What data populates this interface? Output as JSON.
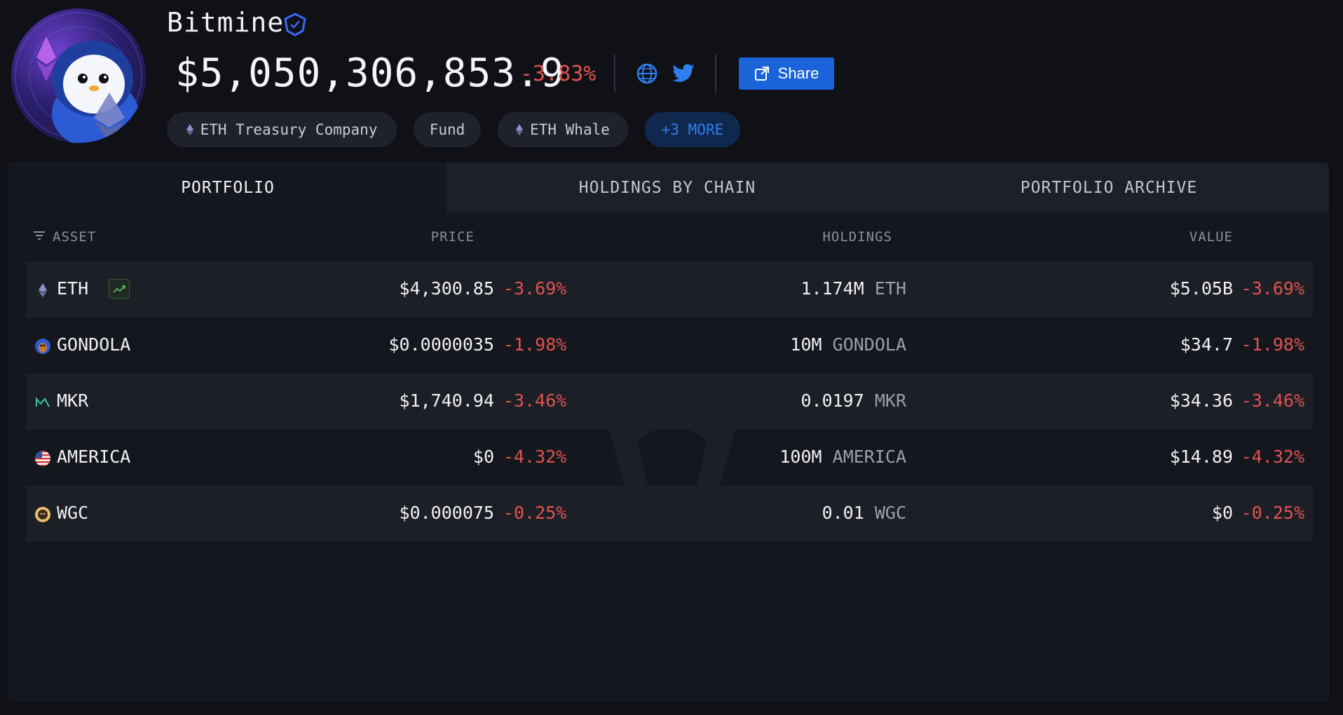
{
  "entity": {
    "name": "Bitmine",
    "total_value": "$5,050,306,853.9",
    "total_change": "-3.83%",
    "share_label": "Share",
    "tags": [
      {
        "label": "ETH Treasury Company",
        "icon": "eth-icon"
      },
      {
        "label": "Fund",
        "icon": ""
      },
      {
        "label": "ETH Whale",
        "icon": "eth-icon"
      },
      {
        "label": "+3 MORE",
        "icon": ""
      }
    ]
  },
  "tabs": [
    {
      "label": "PORTFOLIO",
      "active": true
    },
    {
      "label": "HOLDINGS BY CHAIN",
      "active": false
    },
    {
      "label": "PORTFOLIO ARCHIVE",
      "active": false
    }
  ],
  "table": {
    "headers": {
      "asset": "ASSET",
      "price": "PRICE",
      "holdings": "HOLDINGS",
      "value": "VALUE"
    },
    "rows": [
      {
        "symbol": "ETH",
        "icon": "eth-icon",
        "price": "$4,300.85",
        "price_change": "-3.69%",
        "holdings_amount": "1.174M",
        "holdings_unit": "ETH",
        "value": "$5.05B",
        "value_change": "-3.69%"
      },
      {
        "symbol": "GONDOLA",
        "icon": "gondola-icon",
        "price": "$0.0000035",
        "price_change": "-1.98%",
        "holdings_amount": "10M",
        "holdings_unit": "GONDOLA",
        "value": "$34.7",
        "value_change": "-1.98%"
      },
      {
        "symbol": "MKR",
        "icon": "mkr-icon",
        "price": "$1,740.94",
        "price_change": "-3.46%",
        "holdings_amount": "0.0197",
        "holdings_unit": "MKR",
        "value": "$34.36",
        "value_change": "-3.46%"
      },
      {
        "symbol": "AMERICA",
        "icon": "us-flag-icon",
        "price": "$0",
        "price_change": "-4.32%",
        "holdings_amount": "100M",
        "holdings_unit": "AMERICA",
        "value": "$14.89",
        "value_change": "-4.32%"
      },
      {
        "symbol": "WGC",
        "icon": "wgc-icon",
        "price": "$0.000075",
        "price_change": "-0.25%",
        "holdings_amount": "0.01",
        "holdings_unit": "WGC",
        "value": "$0",
        "value_change": "-0.25%"
      }
    ]
  },
  "colors": {
    "background": "#0f1117",
    "panel": "#15171e",
    "negative": "#e0534f",
    "accent": "#1b63d8"
  }
}
